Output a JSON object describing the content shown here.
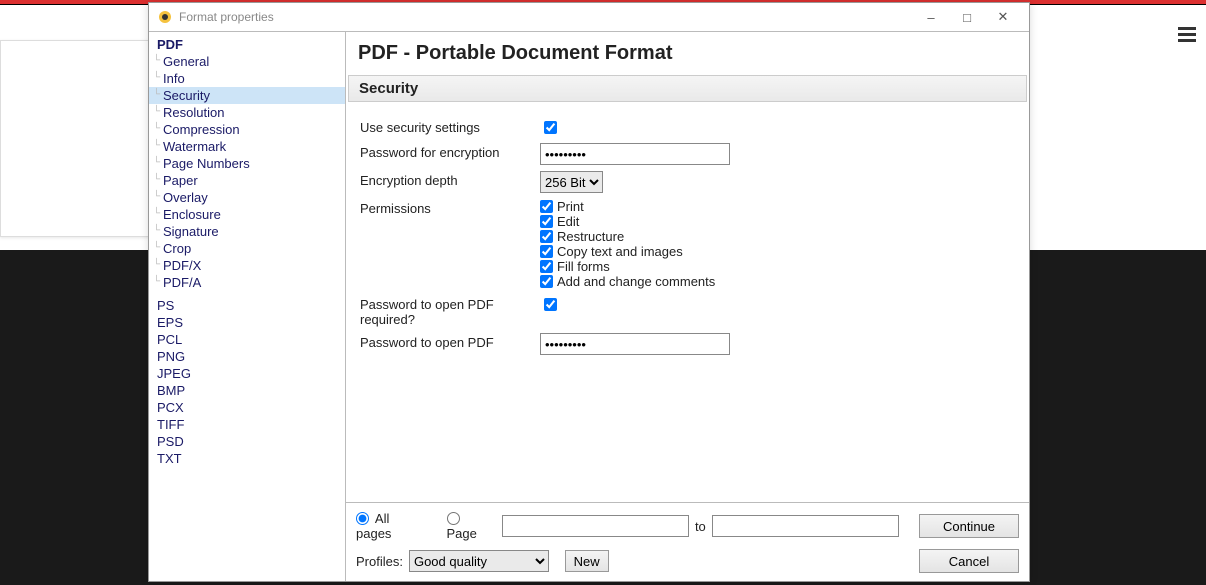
{
  "window": {
    "title": "Format properties",
    "minimize": "–",
    "maximize": "□",
    "close": "✕"
  },
  "hamburger": "≡",
  "sidebar": {
    "pdf": "PDF",
    "subs": {
      "general": "General",
      "info": "Info",
      "security": "Security",
      "resolution": "Resolution",
      "compression": "Compression",
      "watermark": "Watermark",
      "page_numbers": "Page Numbers",
      "paper": "Paper",
      "overlay": "Overlay",
      "enclosure": "Enclosure",
      "signature": "Signature",
      "crop": "Crop",
      "pdfx": "PDF/X",
      "pdfa": "PDF/A"
    },
    "others": {
      "ps": "PS",
      "eps": "EPS",
      "pcl": "PCL",
      "png": "PNG",
      "jpeg": "JPEG",
      "bmp": "BMP",
      "pcx": "PCX",
      "tiff": "TIFF",
      "psd": "PSD",
      "txt": "TXT"
    }
  },
  "main": {
    "title": "PDF - Portable Document Format",
    "section": "Security",
    "labels": {
      "use_sec": "Use security settings",
      "pw_enc": "Password for encryption",
      "enc_depth": "Encryption depth",
      "enc_depth_val": "256 Bit",
      "permissions": "Permissions",
      "perm": {
        "print": "Print",
        "edit": "Edit",
        "restructure": "Restructure",
        "copy": "Copy text and images",
        "fill": "Fill forms",
        "comments": "Add and change comments"
      },
      "pw_open_req": "Password to open PDF required?",
      "pw_open": "Password to open PDF"
    },
    "values": {
      "pw_enc": "●●●●●●●●●",
      "pw_open": "●●●●●●●●●"
    }
  },
  "footer": {
    "all_pages": "All pages",
    "page": "Page",
    "to": "to",
    "profiles": "Profiles:",
    "profile_val": "Good quality",
    "new": "New",
    "continue": "Continue",
    "cancel": "Cancel"
  }
}
